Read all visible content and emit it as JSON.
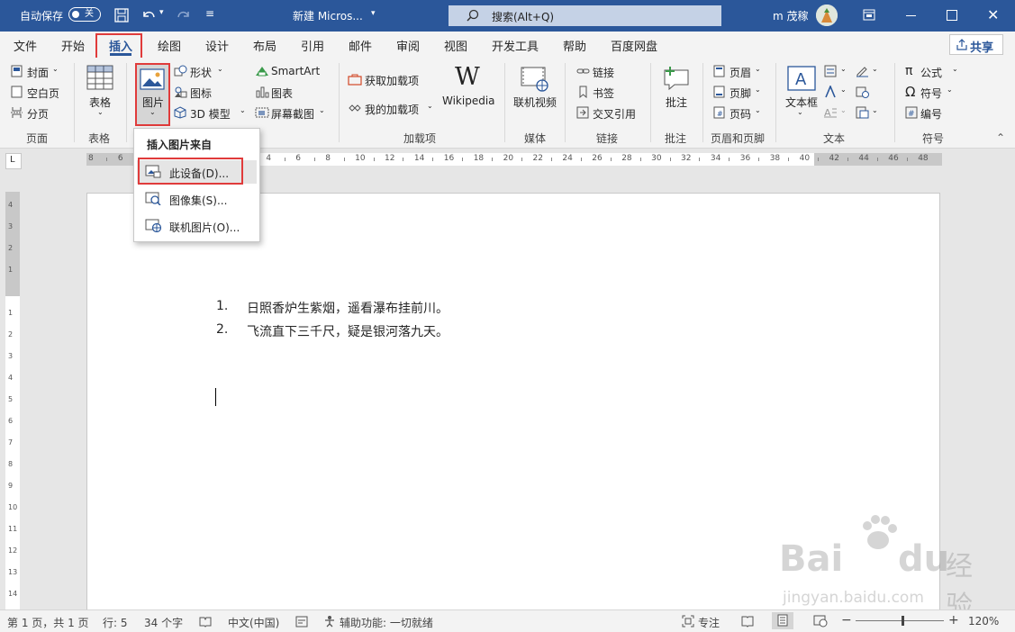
{
  "titlebar": {
    "autosave_label": "自动保存",
    "autosave_state": "关",
    "doc_title": "新建 Micros...",
    "search_label": "搜索(Alt+Q)",
    "user_name": "m 茂稼"
  },
  "tabs": [
    "文件",
    "开始",
    "插入",
    "绘图",
    "设计",
    "布局",
    "引用",
    "邮件",
    "审阅",
    "视图",
    "开发工具",
    "帮助",
    "百度网盘"
  ],
  "share_label": "共享",
  "ribbon": {
    "page_group": {
      "label": "页面",
      "items": [
        "封面",
        "空白页",
        "分页"
      ]
    },
    "table_group": {
      "label": "表格",
      "button": "表格"
    },
    "illustrations": {
      "picture": "图片",
      "shapes": "形状",
      "icons": "图标",
      "model3d": "3D 模型",
      "smartart": "SmartArt",
      "chart": "图表",
      "screenshot": "屏幕截图"
    },
    "addins": {
      "label": "加载项",
      "get": "获取加载项",
      "mine": "我的加载项",
      "wiki": "Wikipedia"
    },
    "media": {
      "label": "媒体",
      "online_video": "联机视频"
    },
    "links": {
      "label": "链接",
      "link": "链接",
      "bookmark": "书签",
      "crossref": "交叉引用"
    },
    "comments": {
      "label": "批注",
      "comment": "批注"
    },
    "header_footer": {
      "label": "页眉和页脚",
      "header": "页眉",
      "footer": "页脚",
      "page_number": "页码"
    },
    "text": {
      "label": "文本",
      "textbox": "文本框"
    },
    "symbols": {
      "label": "符号",
      "equation": "公式",
      "symbol": "符号",
      "number": "编号"
    }
  },
  "dropdown": {
    "header": "插入图片来自",
    "items": [
      "此设备(D)...",
      "图像集(S)...",
      "联机图片(O)..."
    ]
  },
  "ruler_numbers": [
    "8",
    "6",
    "4",
    "2",
    "",
    "2",
    "4",
    "6",
    "8",
    "10",
    "12",
    "14",
    "16",
    "18",
    "20",
    "22",
    "24",
    "26",
    "28",
    "30",
    "32",
    "34",
    "36",
    "38",
    "40",
    "42",
    "44",
    "46",
    "48"
  ],
  "document": {
    "list": [
      {
        "num": "1.",
        "text": "日照香炉生紫烟，遥看瀑布挂前川。"
      },
      {
        "num": "2.",
        "text": "飞流直下三千尺，疑是银河落九天。"
      }
    ]
  },
  "statusbar": {
    "page": "第 1 页，共 1 页",
    "line": "行: 5",
    "words": "34 个字",
    "lang": "中文(中国)",
    "accessibility": "辅助功能: 一切就绪",
    "focus": "专注",
    "zoom": "120%"
  },
  "watermark": {
    "brand": "Bai",
    "brand2": "du",
    "cn": "经验",
    "url": "jingyan.baidu.com"
  },
  "colors": {
    "accent": "#2b579a",
    "highlight": "#e03b3b"
  }
}
